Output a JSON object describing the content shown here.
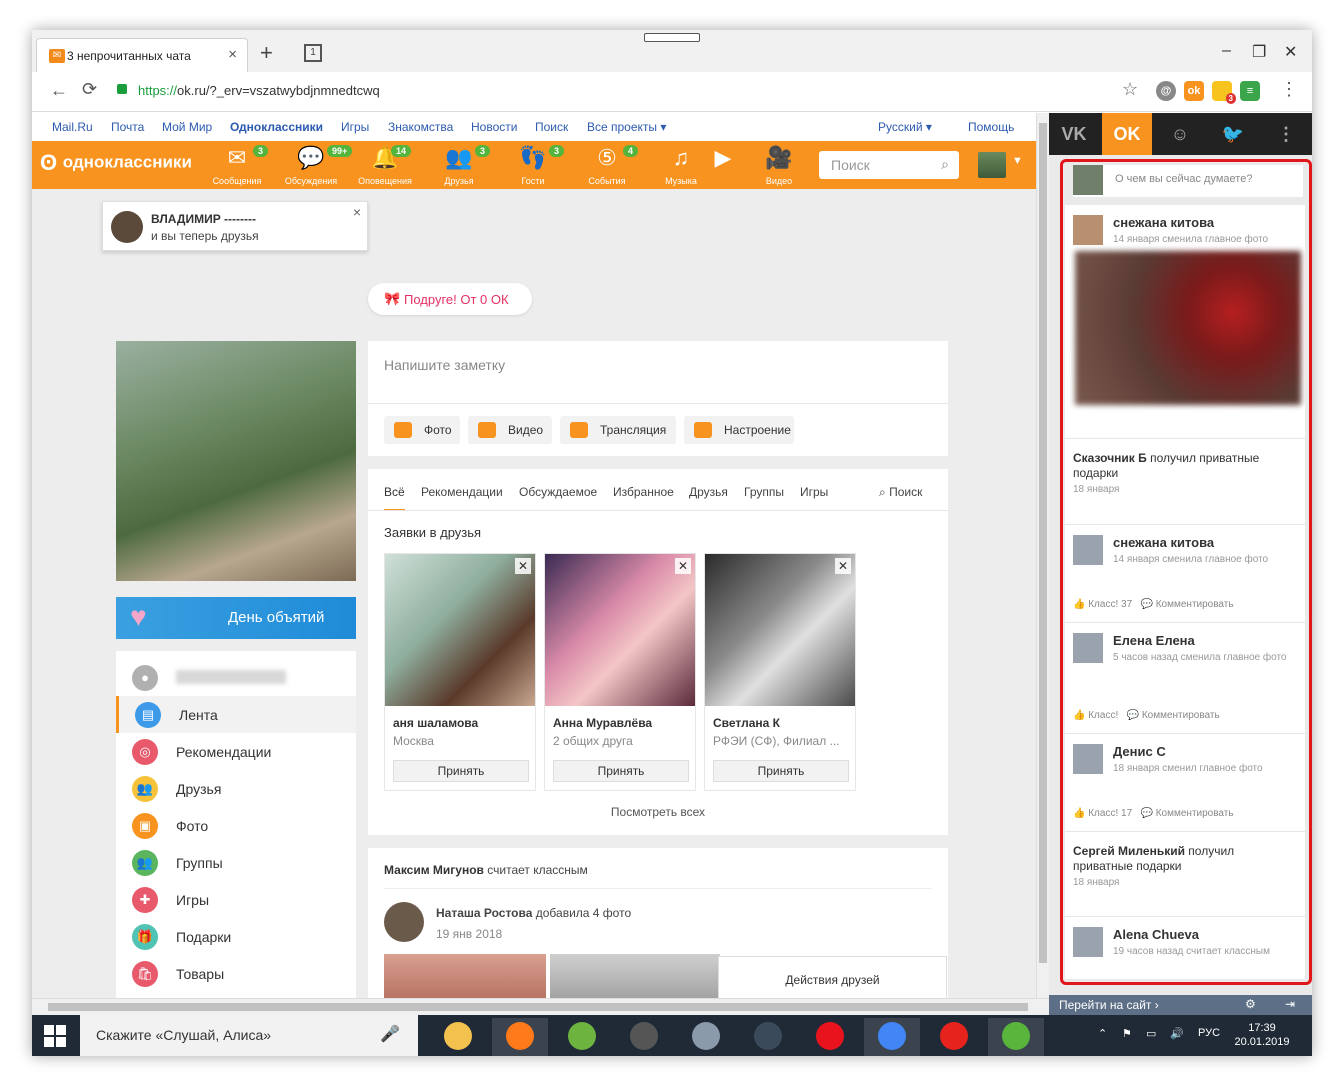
{
  "browser": {
    "tab_title": "3 непрочитанных чата",
    "tab_favicon": "mail-icon",
    "url_scheme": "https://",
    "url_rest": "ok.ru/?_erv=vszatwybdjnmnedtcwq",
    "tabs_count": "1",
    "extension_badge": "3"
  },
  "topnav": [
    "Mail.Ru",
    "Почта",
    "Мой Мир",
    "Одноклассники",
    "Игры",
    "Знакомства",
    "Новости",
    "Поиск",
    "Все проекты ▾"
  ],
  "topnav_right": {
    "lang": "Русский ▾",
    "help": "Помощь"
  },
  "okbar": {
    "logo": "одноклассники",
    "items": [
      {
        "label": "Сообщения",
        "badge": "3",
        "icon": "✉"
      },
      {
        "label": "Обсуждения",
        "badge": "99+",
        "icon": "💬"
      },
      {
        "label": "Оповещения",
        "badge": "14",
        "icon": "🔔"
      },
      {
        "label": "Друзья",
        "badge": "3",
        "icon": "👥"
      },
      {
        "label": "Гости",
        "badge": "3",
        "icon": "👣"
      },
      {
        "label": "События",
        "badge": "4",
        "icon": "⑤"
      },
      {
        "label": "Музыка",
        "badge": "",
        "icon": "♫"
      },
      {
        "label": "",
        "badge": "",
        "icon": "▶"
      },
      {
        "label": "Видео",
        "badge": "",
        "icon": "🎥"
      }
    ],
    "search_placeholder": "Поиск"
  },
  "notice": {
    "name": "ВЛАДИМИР --------",
    "text": "и вы теперь друзья"
  },
  "gift": {
    "text": "Подруге! От 0 ОК"
  },
  "day_banner": "День объятий",
  "left_menu": [
    {
      "label": "",
      "color": "#b0b0b0",
      "icon": "●"
    },
    {
      "label": "Лента",
      "color": "#3d9ae8",
      "icon": "▤"
    },
    {
      "label": "Рекомендации",
      "color": "#e85a6b",
      "icon": "◎"
    },
    {
      "label": "Друзья",
      "color": "#f6c23a",
      "icon": "👥"
    },
    {
      "label": "Фото",
      "color": "#f7931e",
      "icon": "▣"
    },
    {
      "label": "Группы",
      "color": "#5ab55e",
      "icon": "👥"
    },
    {
      "label": "Игры",
      "color": "#e85a6b",
      "icon": "✚"
    },
    {
      "label": "Подарки",
      "color": "#4fc3b4",
      "icon": "🎁"
    },
    {
      "label": "Товары",
      "color": "#e85a6b",
      "icon": "🛍"
    }
  ],
  "post": {
    "placeholder": "Напишите заметку",
    "buttons": [
      "Фото",
      "Видео",
      "Трансляция",
      "Настроение"
    ]
  },
  "feed": {
    "tabs": [
      "Всё",
      "Рекомендации",
      "Обсуждаемое",
      "Избранное",
      "Друзья",
      "Группы",
      "Игры"
    ],
    "search": "Поиск",
    "title": "Заявки в друзья",
    "accept": "Принять",
    "see_all": "Посмотреть всех",
    "cards": [
      {
        "name": "аня шаламова",
        "sub": "Москва",
        "bg": "linear-gradient(135deg,#cfe0d8,#8fae9e 40%,#5a3a2a 70%,#c8a890)"
      },
      {
        "name": "Анна Муравлёва",
        "sub": "2 общих друга",
        "bg": "linear-gradient(135deg,#3a2a52,#d98aa8 40%,#f3c6c6 60%,#5a2a3a)"
      },
      {
        "name": "Светлана К",
        "sub": "РФЭИ (СФ), Филиал ...",
        "bg": "linear-gradient(135deg,#2a2a2a,#8a8a8a 40%,#e0e0e0 60%,#4a4a4a)"
      }
    ]
  },
  "feed2": {
    "actor": "Максим Мигунов",
    "action": "считает классным",
    "poster": "Наташа Ростова",
    "poster_action": "добавила 4 фото",
    "date": "19 янв 2018",
    "friends_actions": "Действия друзей"
  },
  "rside": {
    "tabs": [
      "VK",
      "OK",
      "☺",
      "🐦",
      "⋮"
    ],
    "post_placeholder": "О чем вы сейчас думаете?",
    "items": [
      {
        "name": "снежана китова",
        "desc": "14 января сменила главное фото",
        "likes": "",
        "comment": ""
      },
      {
        "name": "Сказочник Б",
        "gift": "получил приватные подарки",
        "date": "18 января"
      },
      {
        "name": "снежана китова",
        "desc": "14 января сменила главное фото",
        "likes": "Класс! 37",
        "comment": "Комментировать"
      },
      {
        "name": "Елена Елена",
        "desc": "5 часов назад сменила главное фото",
        "likes": "Класс!",
        "comment": "Комментировать"
      },
      {
        "name": "Денис С",
        "desc": "18 января сменил главное фото",
        "likes": "Класс! 17",
        "comment": "Комментировать"
      },
      {
        "name": "Сергей Миленький",
        "gift": "получил приватные подарки",
        "date": "18 января"
      },
      {
        "name": "Alena Chueva",
        "desc": "19 часов назад считает классным",
        "likes": "",
        "comment": ""
      }
    ],
    "footer": "Перейти на сайт ›"
  },
  "taskbar": {
    "search": "Скажите «Слушай, Алиса»",
    "lang": "РУС",
    "time": "17:39",
    "date": "20.01.2019",
    "apps": [
      {
        "name": "file-explorer-icon",
        "color": "#f2c14e"
      },
      {
        "name": "firefox-icon",
        "color": "#ff7a1a"
      },
      {
        "name": "utorrent-icon",
        "color": "#6cb33f"
      },
      {
        "name": "world-of-tanks-icon",
        "color": "#555555"
      },
      {
        "name": "world-of-warplanes-icon",
        "color": "#8a9aaa"
      },
      {
        "name": "world-of-warships-icon",
        "color": "#3a4a5a"
      },
      {
        "name": "opera-icon",
        "color": "#e8131c"
      },
      {
        "name": "chrome-icon",
        "color": "#4285f4"
      },
      {
        "name": "yandex-browser-icon",
        "color": "#e6231c"
      },
      {
        "name": "app-icon",
        "color": "#5ab53c"
      }
    ]
  }
}
